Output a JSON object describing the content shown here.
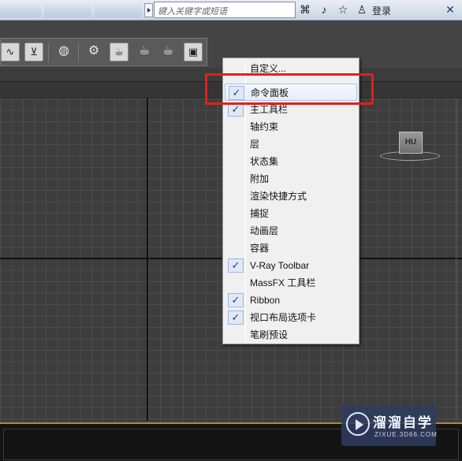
{
  "titlebar": {
    "search_placeholder": "键入关键字或短语",
    "login_label": "登录",
    "close_symbol": "✕",
    "icons": [
      "binoculars-icon",
      "star-icon",
      "user-icon"
    ]
  },
  "toolbar": {
    "tools": [
      "curve-editor-icon",
      "render-setup-icon",
      "material-editor-icon",
      "render-frame-icon",
      "teapot-render-icon",
      "teapot-active-icon",
      "teapot-iterative-icon",
      "render-image-icon"
    ]
  },
  "viewport": {
    "viewcube_label": "HU"
  },
  "context_menu": {
    "items": [
      {
        "label": "自定义...",
        "checked": false
      },
      {
        "label": "命令面板",
        "checked": true
      },
      {
        "label": "主工具栏",
        "checked": true
      },
      {
        "label": "轴约束",
        "checked": false
      },
      {
        "label": "层",
        "checked": false
      },
      {
        "label": "状态集",
        "checked": false
      },
      {
        "label": "附加",
        "checked": false
      },
      {
        "label": "渲染快捷方式",
        "checked": false
      },
      {
        "label": "捕捉",
        "checked": false
      },
      {
        "label": "动画层",
        "checked": false
      },
      {
        "label": "容器",
        "checked": false
      },
      {
        "label": "V-Ray Toolbar",
        "checked": true
      },
      {
        "label": "MassFX 工具栏",
        "checked": false
      },
      {
        "label": "Ribbon",
        "checked": true
      },
      {
        "label": "视口布局选项卡",
        "checked": true
      },
      {
        "label": "笔刷预设",
        "checked": false
      }
    ],
    "check_symbol": "✓"
  },
  "watermark": {
    "title": "溜溜自学",
    "subtitle": "ZIXUE.3D66.COM"
  },
  "colors": {
    "highlight": "#e0201d",
    "viewport_bg": "#3d3d3d",
    "menu_bg": "#f0f0f0"
  }
}
